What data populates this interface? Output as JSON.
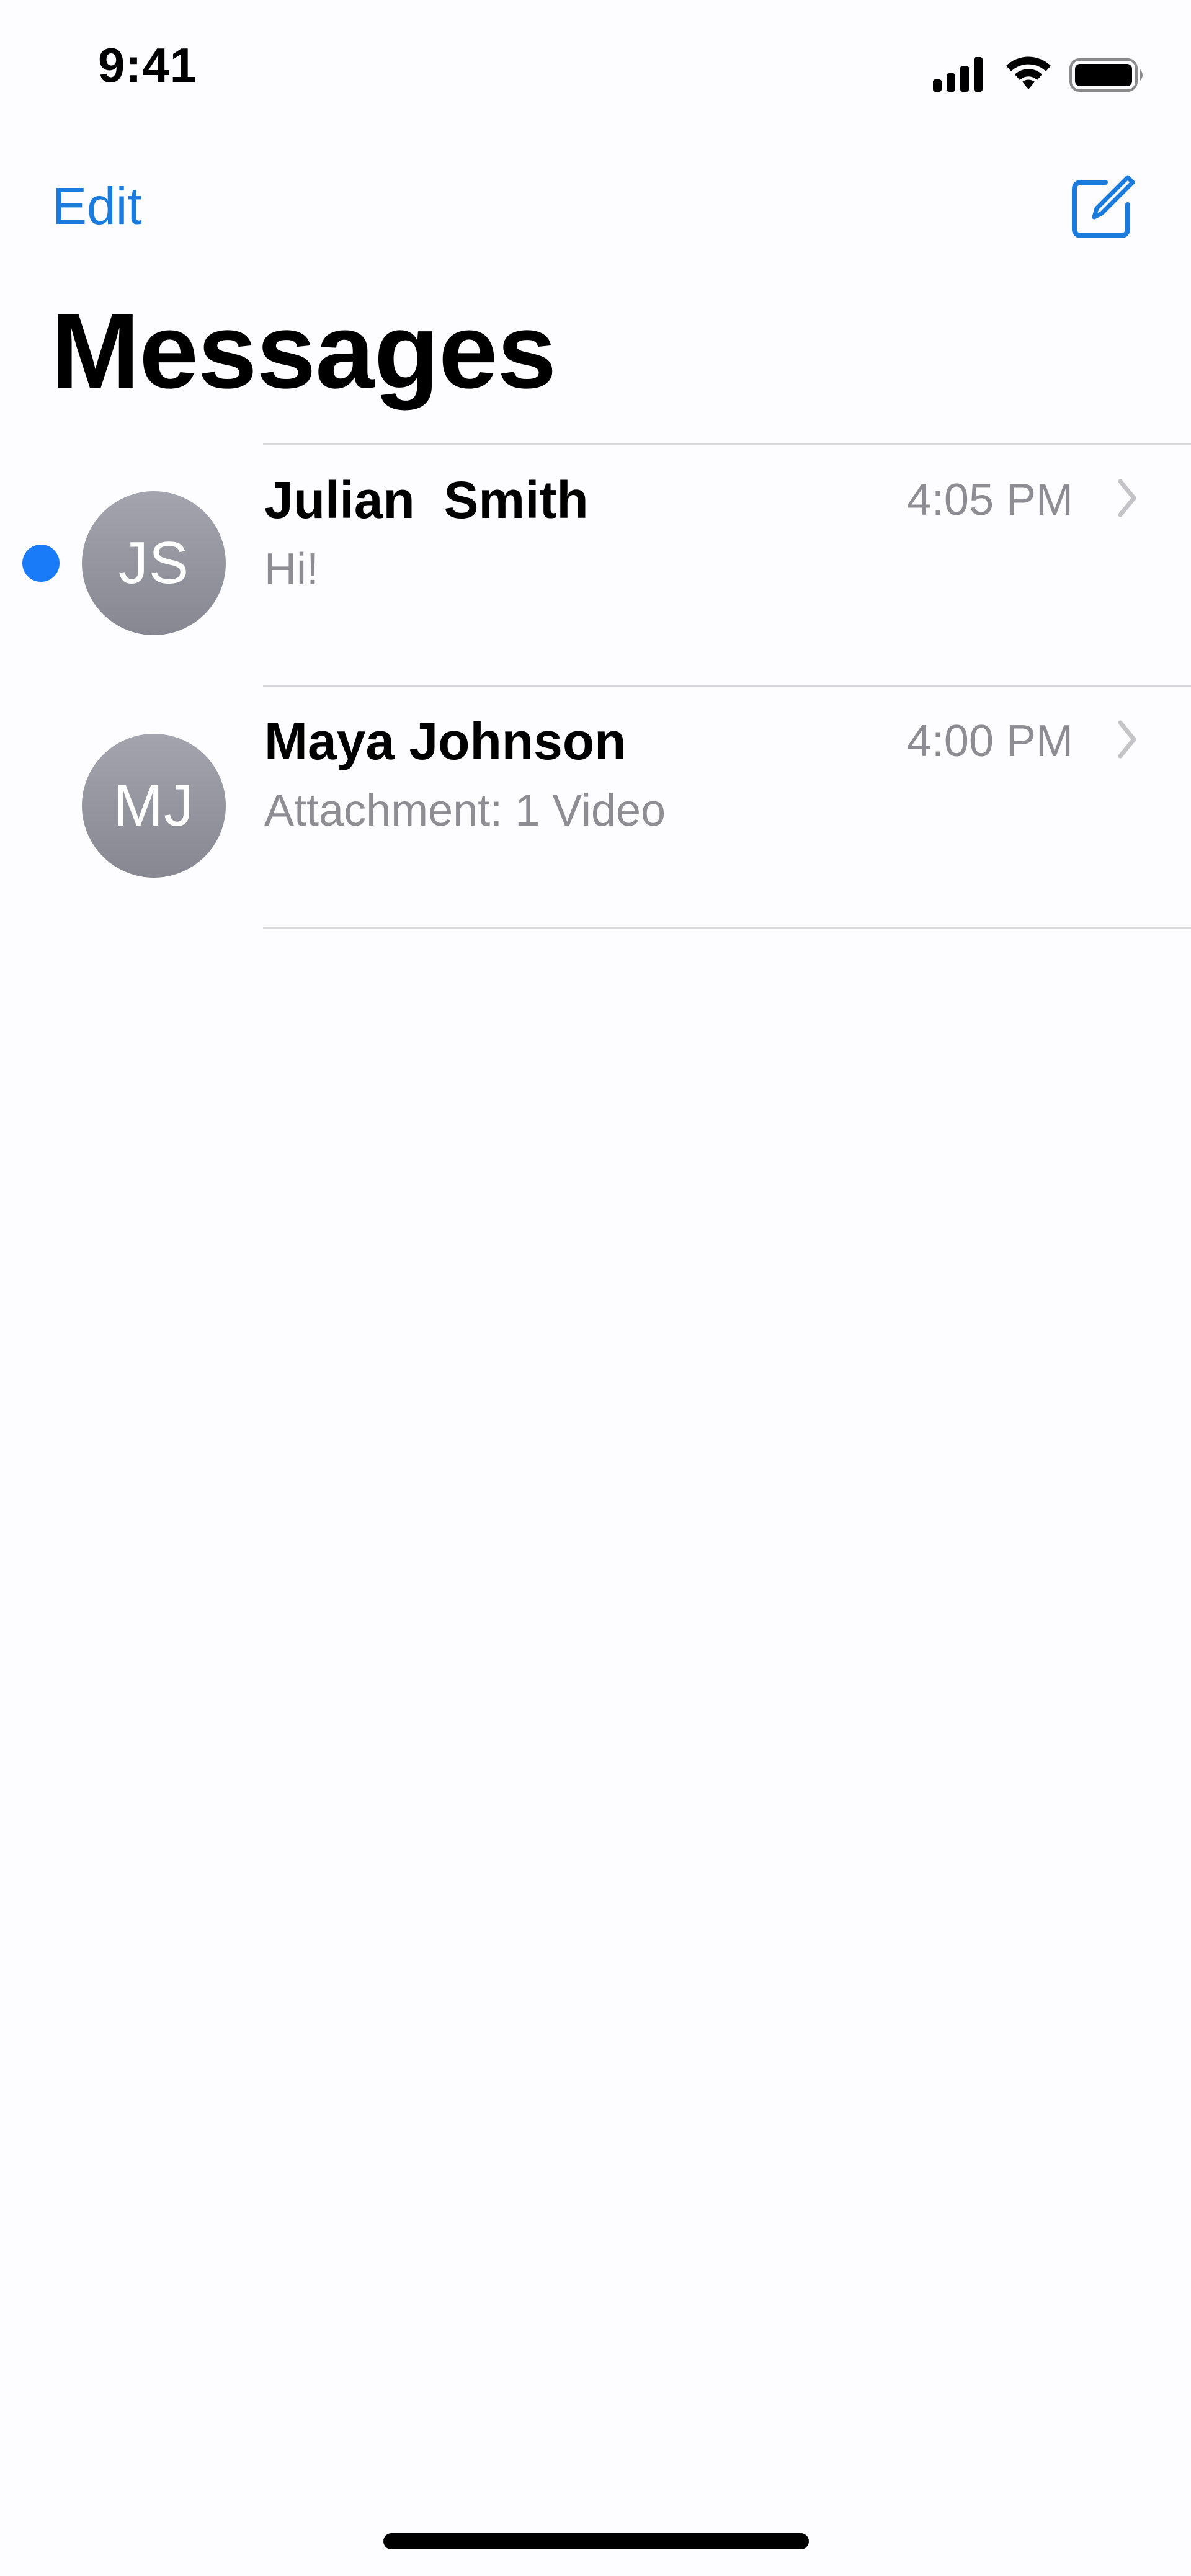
{
  "status_bar": {
    "time": "9:41",
    "icons": [
      "cellular-signal-icon",
      "wifi-icon",
      "battery-icon"
    ]
  },
  "nav": {
    "edit_label": "Edit",
    "compose_icon": "compose-icon",
    "title": "Messages"
  },
  "conversations": [
    {
      "initials": "JS",
      "name": "Julian  Smith",
      "preview": "Hi!",
      "time": "4:05 PM",
      "unread": true
    },
    {
      "initials": "MJ",
      "name": "Maya Johnson",
      "preview": "Attachment: 1 Video",
      "time": "4:00 PM",
      "unread": false
    }
  ],
  "colors": {
    "accent": "#1a7bdc",
    "unread_dot": "#1a7bf8",
    "secondary_text": "#8e8d93",
    "background": "#fdfcfe"
  }
}
